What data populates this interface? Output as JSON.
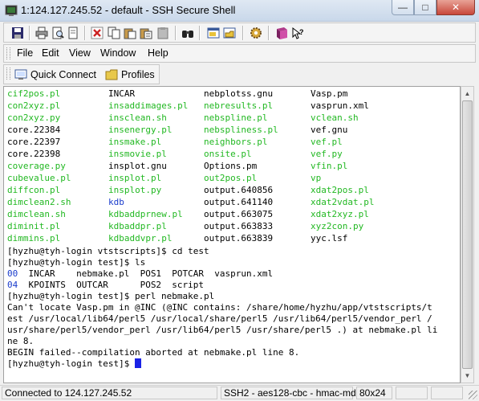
{
  "window": {
    "title": "1:124.127.245.52 - default - SSH Secure Shell"
  },
  "window_controls": {
    "minimize": "—",
    "maximize": "□",
    "close": "✕"
  },
  "toolbar": {
    "buttons": [
      "save-icon",
      "print-icon",
      "print-preview-icon",
      "find-icon",
      "copy-icon",
      "paste-icon",
      "paste-special-icon",
      "clipboard-icon",
      "binoculars-icon",
      "new-terminal-icon",
      "new-file-transfer-icon",
      "settings-gear-icon",
      "profiles-book-icon",
      "help-pointer-icon"
    ]
  },
  "menu": {
    "file": "File",
    "edit": "Edit",
    "view": "View",
    "window": "Window",
    "help": "Help"
  },
  "quickbar": {
    "quick_connect": "Quick Connect",
    "profiles": "Profiles"
  },
  "colors": {
    "green": "#22b822",
    "blue": "#1a3ccc",
    "cursor": "#1a22e6"
  },
  "terminal": {
    "listing": [
      [
        [
          "cif2pos.pl",
          "g"
        ],
        [
          "INCAR",
          "k"
        ],
        [
          "nebplotss.gnu",
          "k"
        ],
        [
          "Vasp.pm",
          "k"
        ]
      ],
      [
        [
          "con2xyz.pl",
          "g"
        ],
        [
          "insaddimages.pl",
          "g"
        ],
        [
          "nebresults.pl",
          "g"
        ],
        [
          "vasprun.xml",
          "k"
        ]
      ],
      [
        [
          "con2xyz.py",
          "g"
        ],
        [
          "insclean.sh",
          "g"
        ],
        [
          "nebspline.pl",
          "g"
        ],
        [
          "vclean.sh",
          "g"
        ]
      ],
      [
        [
          "core.22384",
          "k"
        ],
        [
          "insenergy.pl",
          "g"
        ],
        [
          "nebspliness.pl",
          "g"
        ],
        [
          "vef.gnu",
          "k"
        ]
      ],
      [
        [
          "core.22397",
          "k"
        ],
        [
          "insmake.pl",
          "g"
        ],
        [
          "neighbors.pl",
          "g"
        ],
        [
          "vef.pl",
          "g"
        ]
      ],
      [
        [
          "core.22398",
          "k"
        ],
        [
          "insmovie.pl",
          "g"
        ],
        [
          "onsite.pl",
          "g"
        ],
        [
          "vef.py",
          "g"
        ]
      ],
      [
        [
          "coverage.py",
          "g"
        ],
        [
          "insplot.gnu",
          "k"
        ],
        [
          "Options.pm",
          "k"
        ],
        [
          "vfin.pl",
          "g"
        ]
      ],
      [
        [
          "cubevalue.pl",
          "g"
        ],
        [
          "insplot.pl",
          "g"
        ],
        [
          "out2pos.pl",
          "g"
        ],
        [
          "vp",
          "g"
        ]
      ],
      [
        [
          "diffcon.pl",
          "g"
        ],
        [
          "insplot.py",
          "g"
        ],
        [
          "output.640856",
          "k"
        ],
        [
          "xdat2pos.pl",
          "g"
        ]
      ],
      [
        [
          "dimclean2.sh",
          "g"
        ],
        [
          "kdb",
          "b"
        ],
        [
          "output.641140",
          "k"
        ],
        [
          "xdat2vdat.pl",
          "g"
        ]
      ],
      [
        [
          "dimclean.sh",
          "g"
        ],
        [
          "kdbaddprnew.pl",
          "g"
        ],
        [
          "output.663075",
          "k"
        ],
        [
          "xdat2xyz.pl",
          "g"
        ]
      ],
      [
        [
          "diminit.pl",
          "g"
        ],
        [
          "kdbaddpr.pl",
          "g"
        ],
        [
          "output.663833",
          "k"
        ],
        [
          "xyz2con.py",
          "g"
        ]
      ],
      [
        [
          "dimmins.pl",
          "g"
        ],
        [
          "kdbaddvpr.pl",
          "g"
        ],
        [
          "output.663839",
          "k"
        ],
        [
          "yyc.lsf",
          "k"
        ]
      ]
    ],
    "cmd1": "[hyzhu@tyh-login vtstscripts]$ cd test",
    "cmd2": "[hyzhu@tyh-login test]$ ls",
    "ls_row1": {
      "dir": "00",
      "rest": "  INCAR    nebmake.pl  POS1  POTCAR  vasprun.xml"
    },
    "ls_row2": {
      "dir": "04",
      "rest": "  KPOINTS  OUTCAR      POS2  script"
    },
    "cmd3": "[hyzhu@tyh-login test]$ perl nebmake.pl",
    "err1": "Can't locate Vasp.pm in @INC (@INC contains: /share/home/hyzhu/app/vtstscripts/t",
    "err2": "est /usr/local/lib64/perl5 /usr/local/share/perl5 /usr/lib64/perl5/vendor_perl /",
    "err3": "usr/share/perl5/vendor_perl /usr/lib64/perl5 /usr/share/perl5 .) at nebmake.pl li",
    "err4": "ne 8.",
    "err5": "BEGIN failed--compilation aborted at nebmake.pl line 8.",
    "prompt": "[hyzhu@tyh-login test]$ "
  },
  "status": {
    "connection": "Connected to 124.127.245.52",
    "cipher": "SSH2 - aes128-cbc - hmac-md5",
    "size": "80x24"
  }
}
